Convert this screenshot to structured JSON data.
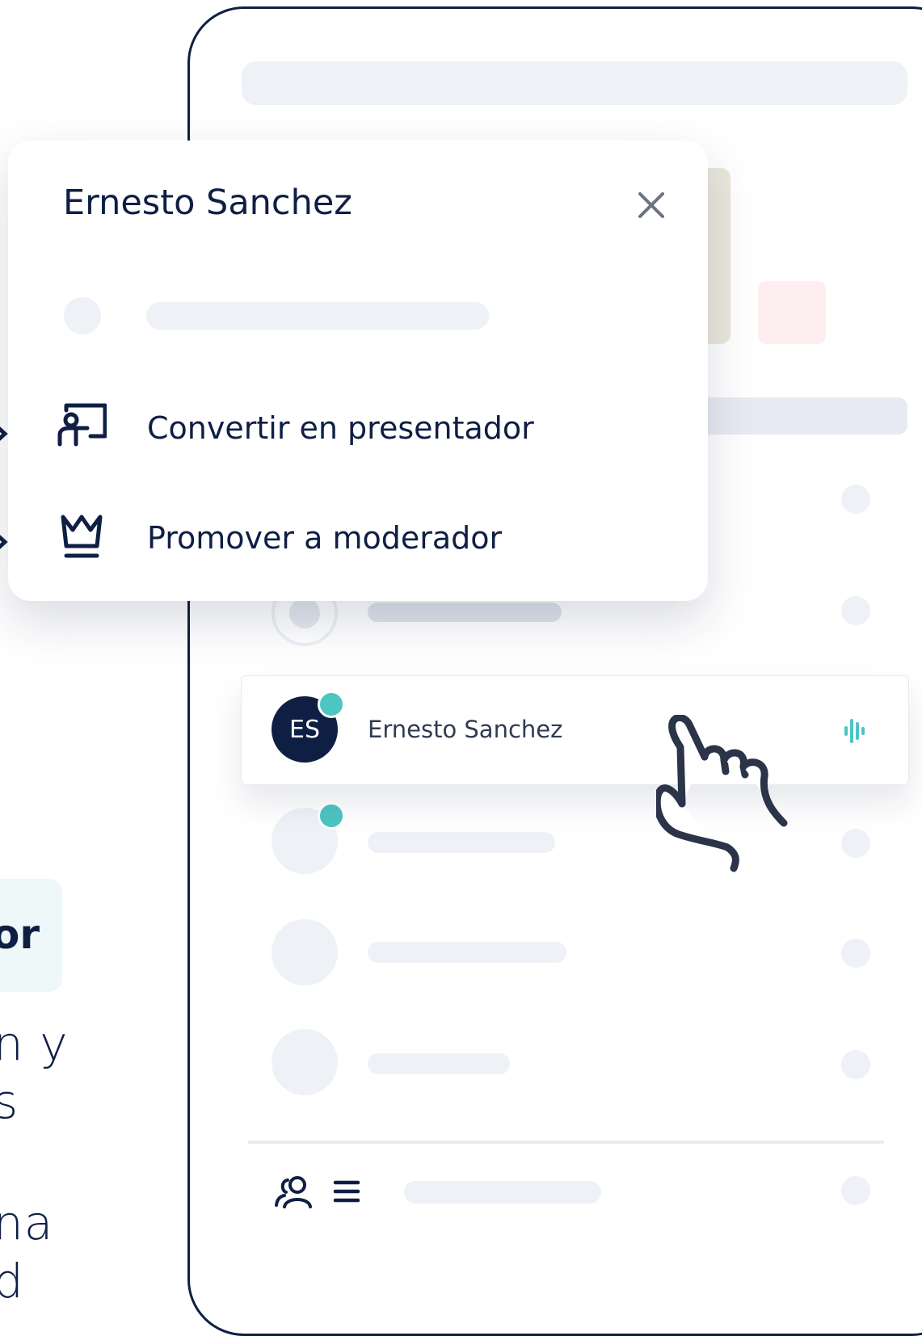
{
  "menu": {
    "title": "Ernesto Sanchez",
    "items": [
      {
        "label": "Convertir en presentador",
        "icon": "presenter-icon"
      },
      {
        "label": "Promover a moderador",
        "icon": "crown-icon"
      }
    ],
    "close_icon": "close-icon"
  },
  "participant": {
    "initials": "ES",
    "name": "Ernesto Sanchez",
    "status_icon": "audio-level-icon",
    "online": true
  },
  "left_text": {
    "badge_fragment": "or",
    "line1": "n y",
    "line2": "s",
    "line3": "na",
    "line4": "d"
  },
  "footer": {
    "icons": [
      "participants-icon",
      "list-icon"
    ]
  },
  "colors": {
    "navy": "#0f1f44",
    "teal": "#4dc5c1",
    "skeleton": "#eef1f6"
  }
}
